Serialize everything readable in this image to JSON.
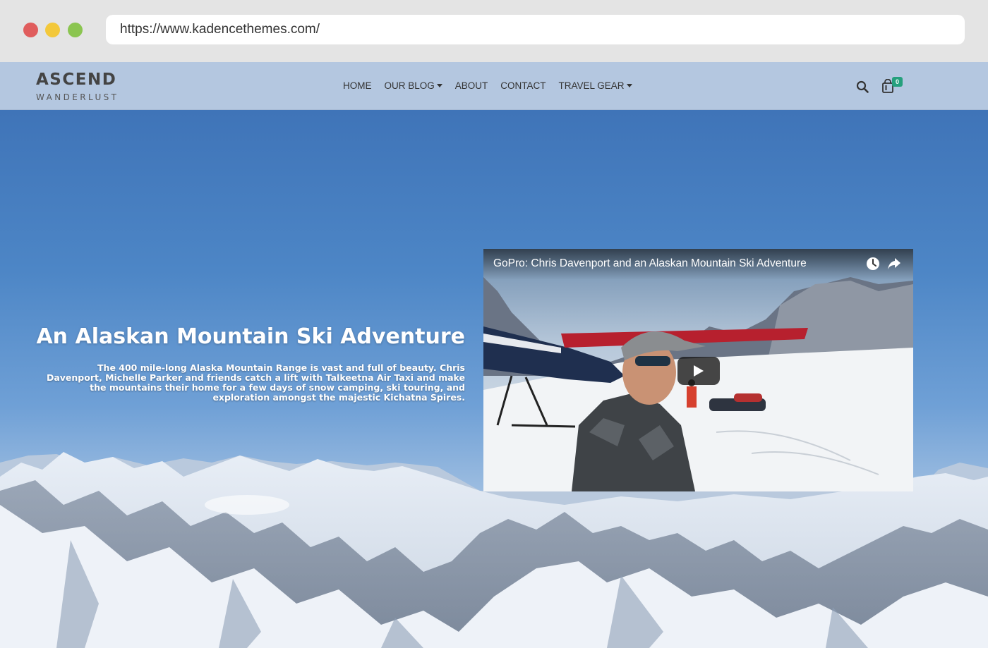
{
  "browser": {
    "url": "https://www.kadencethemes.com/"
  },
  "header": {
    "logo_title": "ASCEND",
    "logo_subtitle": "WANDERLUST",
    "nav": [
      {
        "label": "HOME",
        "has_dropdown": false
      },
      {
        "label": "OUR BLOG",
        "has_dropdown": true
      },
      {
        "label": "ABOUT",
        "has_dropdown": false
      },
      {
        "label": "CONTACT",
        "has_dropdown": false
      },
      {
        "label": "TRAVEL GEAR",
        "has_dropdown": true
      }
    ],
    "search_icon": "search-icon",
    "cart_icon": "shopping-bag-icon",
    "cart_count": "0"
  },
  "hero": {
    "title": "An Alaskan Mountain Ski Adventure",
    "description": "The 400 mile-long Alaska Mountain Range is vast and full of beauty. Chris Davenport, Michelle Parker and friends catch a lift with Talkeetna Air Taxi and make the mountains their home for a few days of snow camping, ski touring, and exploration amongst the majestic Kichatna Spires."
  },
  "video": {
    "title": "GoPro: Chris Davenport and an Alaskan Mountain Ski Adventure",
    "icons": [
      "clock-icon",
      "share-icon",
      "play-icon"
    ]
  },
  "colors": {
    "header_bg": "#b4c7e0",
    "cart_badge": "#25a07d",
    "sky_top": "#3f74b8"
  }
}
